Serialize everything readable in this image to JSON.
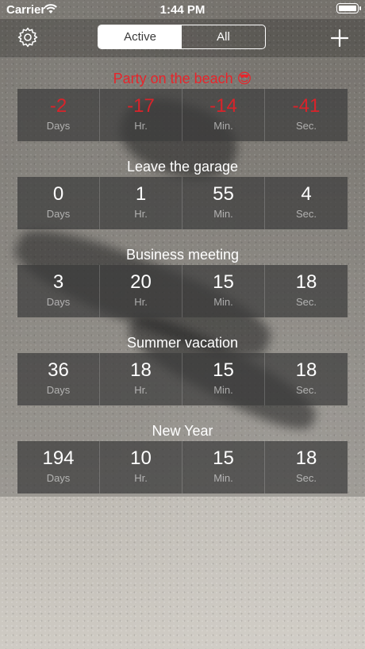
{
  "status_bar": {
    "carrier": "Carrier",
    "time": "1:44 PM"
  },
  "nav": {
    "segments": [
      {
        "label": "Active",
        "selected": true
      },
      {
        "label": "All",
        "selected": false
      }
    ]
  },
  "events": [
    {
      "title": "Party on the beach 😎",
      "past": true,
      "values": [
        "-2",
        "-17",
        "-14",
        "-41"
      ],
      "labels": [
        "Days",
        "Hr.",
        "Min.",
        "Sec."
      ]
    },
    {
      "title": "Leave the garage",
      "past": false,
      "values": [
        "0",
        "1",
        "55",
        "4"
      ],
      "labels": [
        "Days",
        "Hr.",
        "Min.",
        "Sec."
      ]
    },
    {
      "title": "Business meeting",
      "past": false,
      "values": [
        "3",
        "20",
        "15",
        "18"
      ],
      "labels": [
        "Days",
        "Hr.",
        "Min.",
        "Sec."
      ]
    },
    {
      "title": "Summer vacation",
      "past": false,
      "values": [
        "36",
        "18",
        "15",
        "18"
      ],
      "labels": [
        "Days",
        "Hr.",
        "Min.",
        "Sec."
      ]
    },
    {
      "title": "New Year",
      "past": false,
      "values": [
        "194",
        "10",
        "15",
        "18"
      ],
      "labels": [
        "Days",
        "Hr.",
        "Min.",
        "Sec."
      ]
    }
  ],
  "colors": {
    "past_event": "#e8252b",
    "cell_bg": "#3c3c3c"
  },
  "icons": {
    "settings": "gear-icon",
    "add": "plus-icon",
    "wifi": "wifi-icon",
    "battery": "battery-icon"
  }
}
